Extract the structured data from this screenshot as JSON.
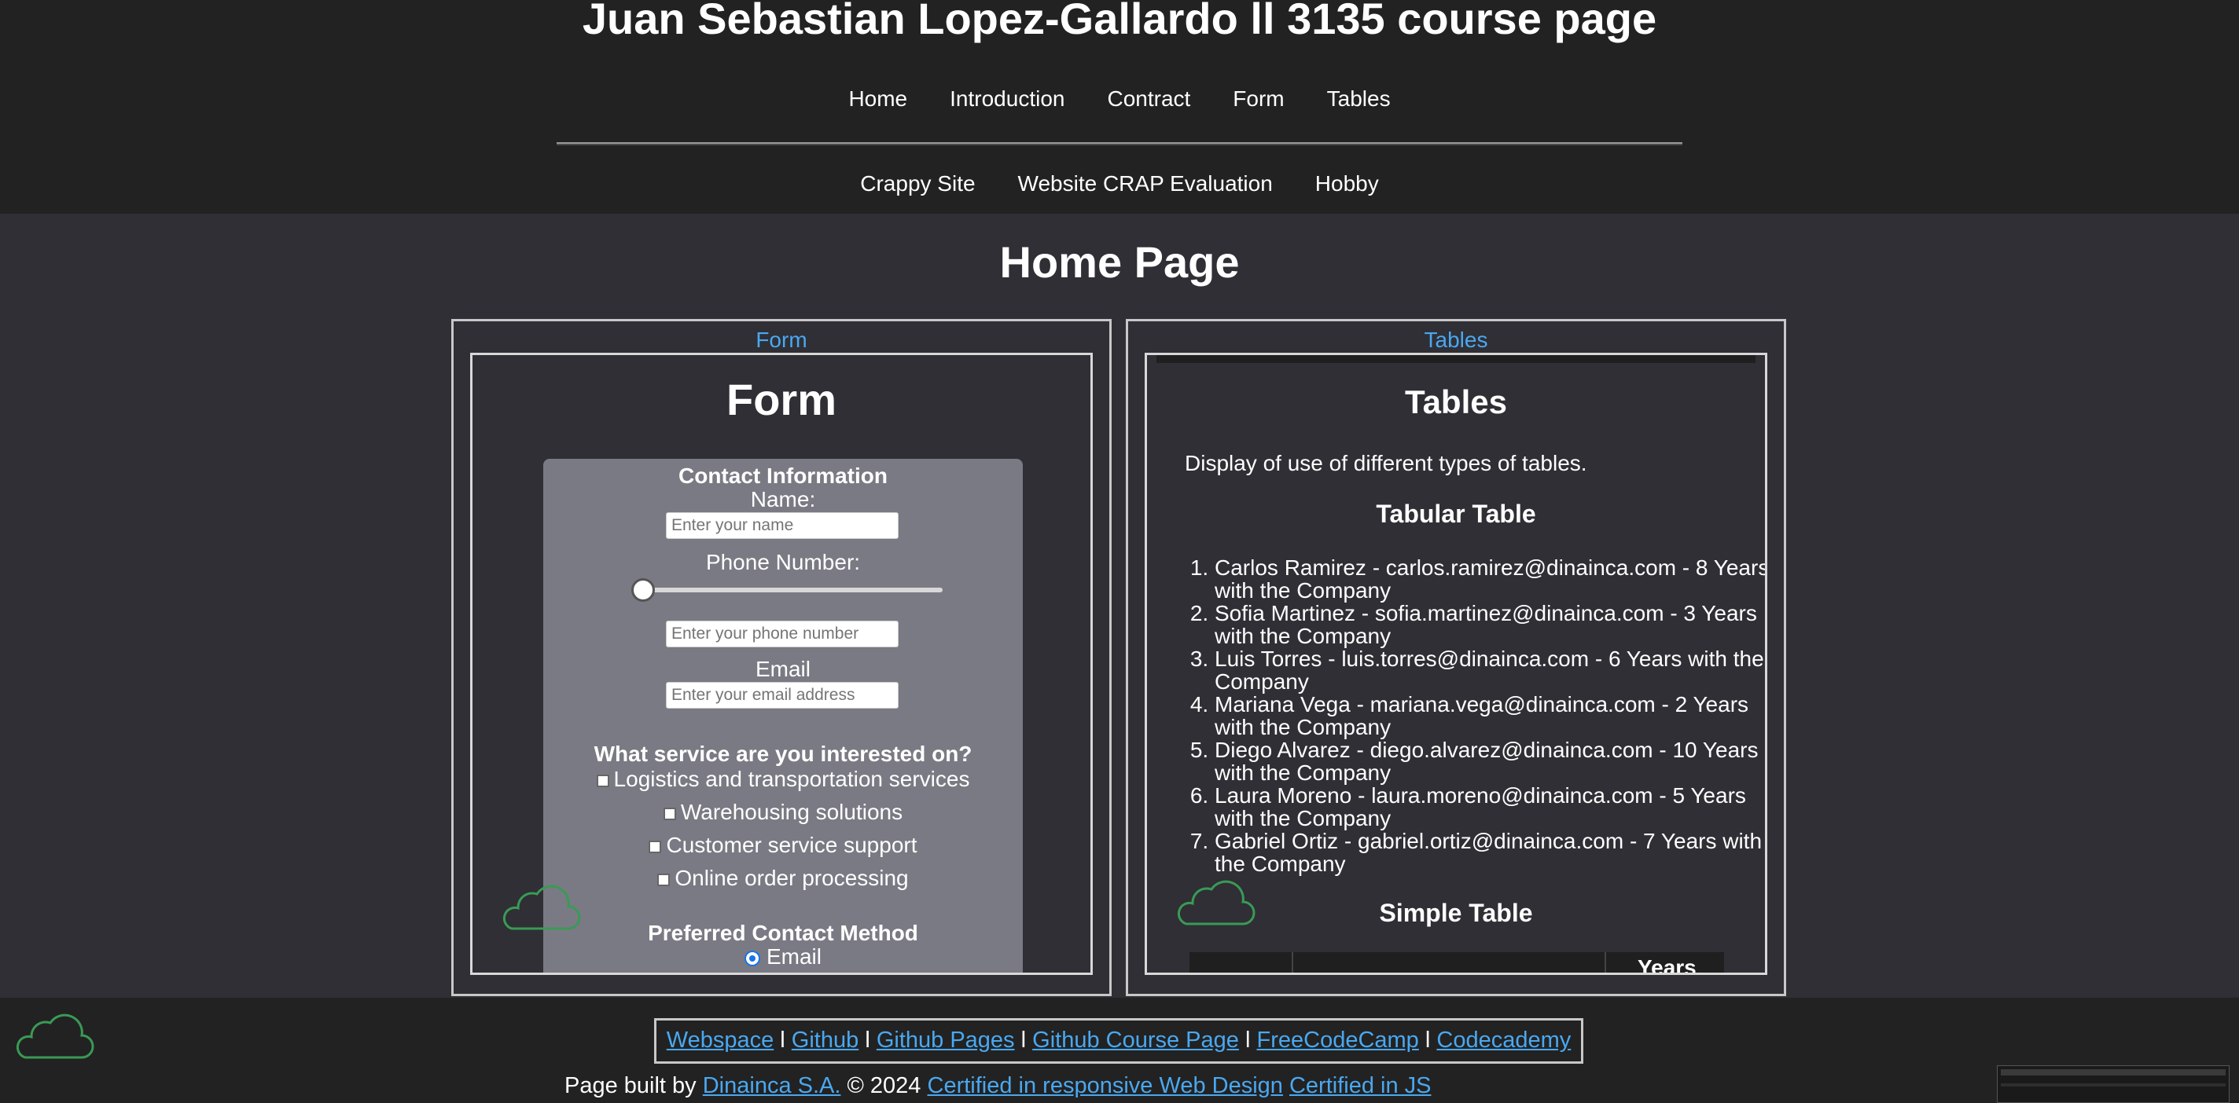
{
  "header": {
    "title": "Juan Sebastian Lopez-Gallardo ll 3135 course page",
    "nav_primary": [
      "Home",
      "Introduction",
      "Contract",
      "Form",
      "Tables"
    ],
    "nav_secondary": [
      "Crappy Site",
      "Website CRAP Evaluation",
      "Hobby"
    ]
  },
  "main": {
    "page_title": "Home Page",
    "form_panel": {
      "link": "Form",
      "title": "Form",
      "contact_heading": "Contact Information",
      "name_label": "Name:",
      "name_placeholder": "Enter your name",
      "phone_label": "Phone Number:",
      "phone_slider_level": 0,
      "phone_placeholder": "Enter your phone number",
      "email_label": "Email",
      "email_placeholder": "Enter your email address",
      "service_heading": "What service are you interested on?",
      "services": [
        "Logistics and transportation services",
        "Warehousing solutions",
        "Customer service support",
        "Online order processing"
      ],
      "contact_method_heading": "Preferred Contact Method",
      "contact_method_option": "Email"
    },
    "tables_panel": {
      "link": "Tables",
      "title": "Tables",
      "description": "Display of use of different types of tables.",
      "tabular_heading": "Tabular Table",
      "employees": [
        "Carlos Ramirez - carlos.ramirez@dinainca.com - 8 Years with the Company",
        "Sofia Martinez - sofia.martinez@dinainca.com - 3 Years with the Company",
        "Luis Torres - luis.torres@dinainca.com - 6 Years with the Company",
        "Mariana Vega - mariana.vega@dinainca.com - 2 Years with the Company",
        "Diego Alvarez - diego.alvarez@dinainca.com - 10 Years with the Company",
        "Laura Moreno - laura.moreno@dinainca.com - 5 Years with the Company",
        "Gabriel Ortiz - gabriel.ortiz@dinainca.com - 7 Years with the Company"
      ],
      "simple_heading": "Simple Table",
      "simple_table_partial_header": "Years"
    }
  },
  "footer": {
    "links": [
      "Webspace",
      "Github",
      "Github Pages",
      "Github Course Page",
      "FreeCodeCamp",
      "Codecademy"
    ],
    "separator": "l",
    "built_by_prefix": "Page built by",
    "company": "Dinainca S.A.",
    "copyright": "© 2024",
    "cert1": "Certified in responsive Web Design",
    "cert2": "Certified in JS"
  },
  "icons": {
    "cloud_color": "#3a9a55"
  }
}
